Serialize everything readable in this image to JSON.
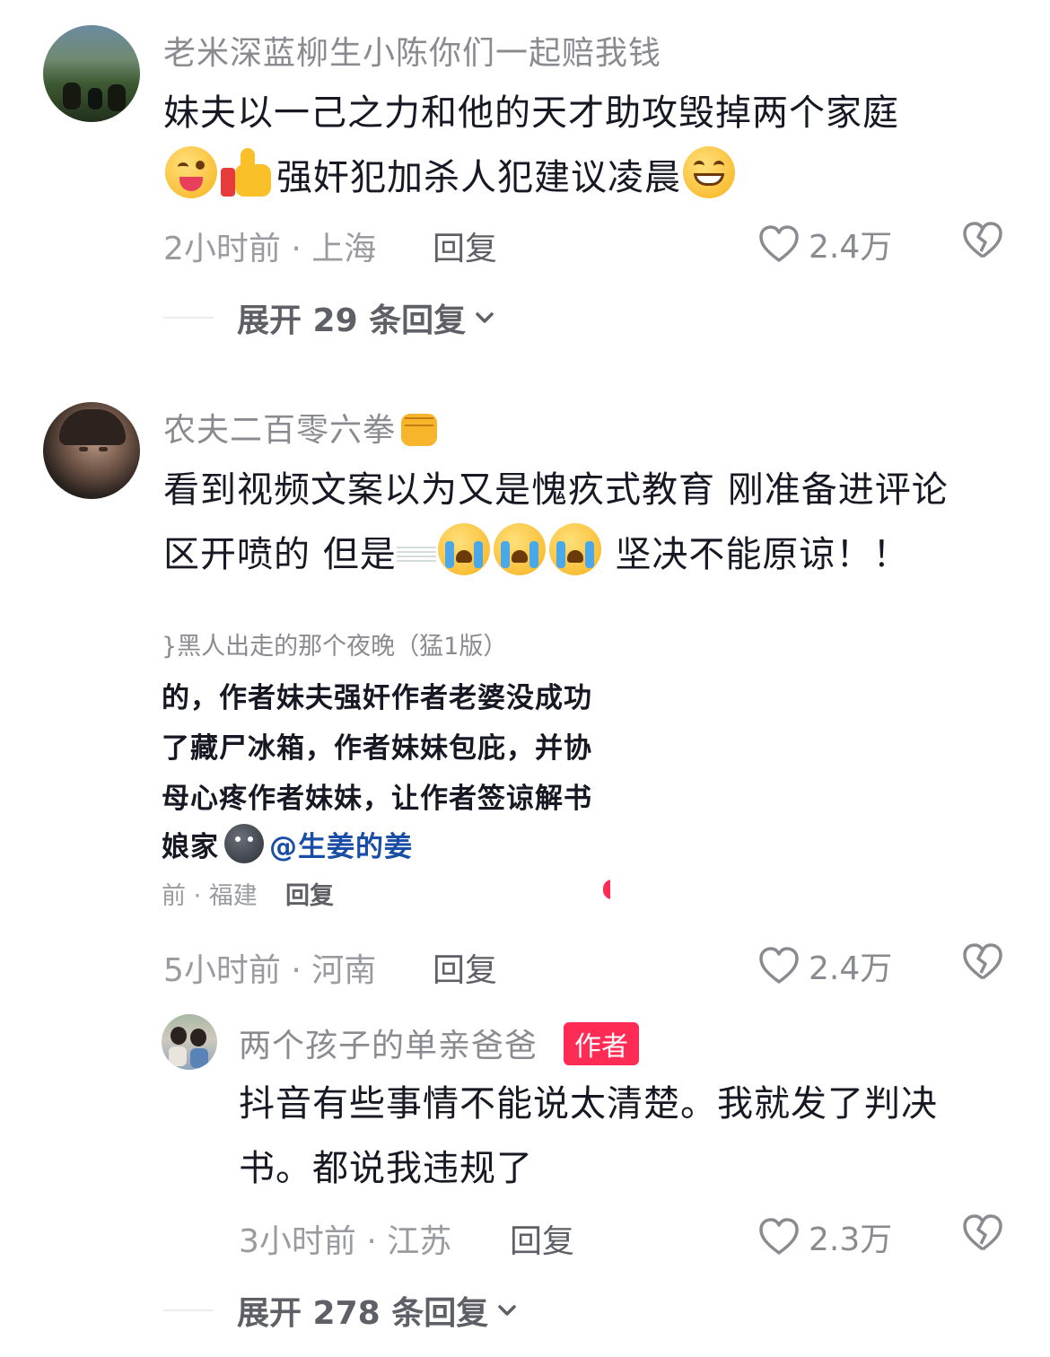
{
  "comments": [
    {
      "username": "老米深蓝柳生小陈你们一起赔我钱",
      "text_line1": "妹夫以一己之力和他的天才助攻毁掉两个家庭",
      "text_line2": "强奸犯加杀人犯建议凌晨",
      "time_location": "2小时前 · 上海",
      "reply_label": "回复",
      "likes": "2.4万",
      "expand_label": "展开 29 条回复"
    },
    {
      "username": "农夫二百零六拳",
      "text_line1": "看到视频文案以为又是愧疚式教育 刚准备进评论",
      "text_line2_a": "区开喷的 但是",
      "text_line2_b": "坚决不能原谅！！",
      "time_location": "5小时前 · 河南",
      "reply_label": "回复",
      "likes": "2.4万",
      "embedded_screenshot": {
        "header": "}黑人出走的那个夜晚（猛1版）",
        "line1": "的，作者妹夫强奸作者老婆没成功",
        "line2": "了藏尸冰箱，作者妹妹包庇，并协",
        "line3": "母心疼作者妹妹，让作者签谅解书",
        "line4_text": "娘家",
        "line4_mention": "@生姜的姜",
        "meta": "前 · 福建",
        "reply": "回复"
      }
    }
  ],
  "reply": {
    "username": "两个孩子的单亲爸爸",
    "badge": "作者",
    "text_line1": "抖音有些事情不能说太清楚。我就发了判决",
    "text_line2": "书。都说我违规了",
    "time_location": "3小时前 · 江苏",
    "reply_label": "回复",
    "likes": "2.3万",
    "expand_label": "展开 278 条回复"
  },
  "colors": {
    "badge": "#fe2c55",
    "mention": "#1a4ea6",
    "username": "#8a8b91"
  }
}
